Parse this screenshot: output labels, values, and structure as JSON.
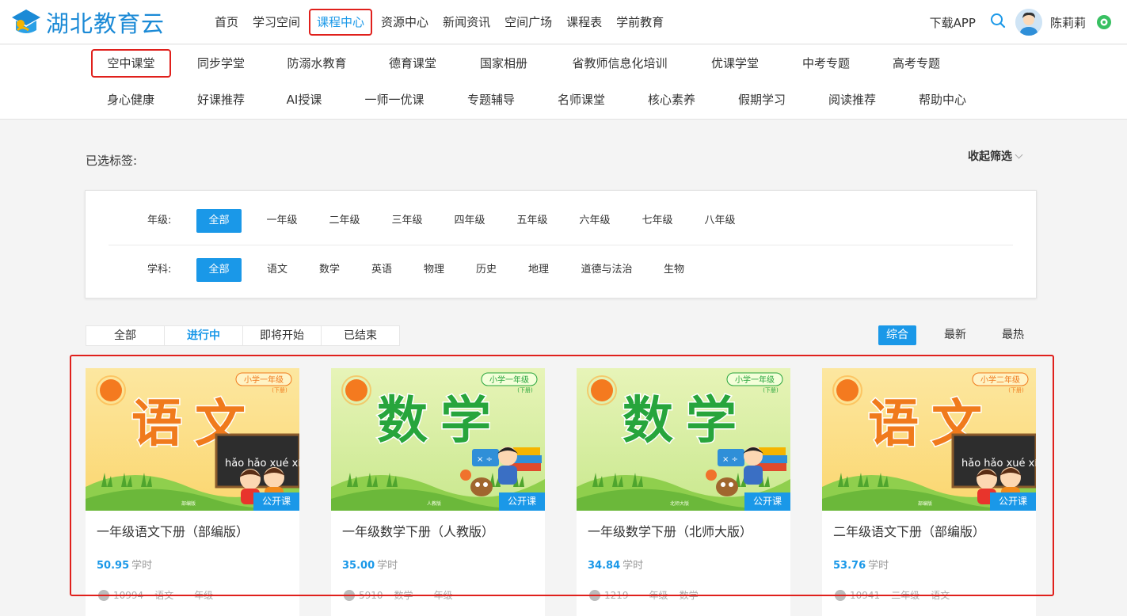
{
  "brand": {
    "name": "湖北教育云"
  },
  "nav": {
    "items": [
      "首页",
      "学习空间",
      "课程中心",
      "资源中心",
      "新闻资讯",
      "空间广场",
      "课程表",
      "学前教育"
    ],
    "active_index": 2
  },
  "user": {
    "download": "下载APP",
    "name": "陈莉莉"
  },
  "subnav": {
    "row1": [
      "空中课堂",
      "同步学堂",
      "防溺水教育",
      "德育课堂",
      "国家相册",
      "省教师信息化培训",
      "优课学堂",
      "中考专题",
      "高考专题"
    ],
    "row2": [
      "身心健康",
      "好课推荐",
      "AI授课",
      "一师一优课",
      "专题辅导",
      "名师课堂",
      "核心素养",
      "假期学习",
      "阅读推荐",
      "帮助中心"
    ],
    "active": "空中课堂"
  },
  "filter": {
    "selected_label": "已选标签:",
    "collapse_label": "收起筛选",
    "grade_label": "年级:",
    "grades": [
      "全部",
      "一年级",
      "二年级",
      "三年级",
      "四年级",
      "五年级",
      "六年级",
      "七年级",
      "八年级"
    ],
    "subject_label": "学科:",
    "subjects": [
      "全部",
      "语文",
      "数学",
      "英语",
      "物理",
      "历史",
      "地理",
      "道德与法治",
      "生物"
    ]
  },
  "status_tabs": [
    "全部",
    "进行中",
    "即将开始",
    "已结束"
  ],
  "status_active": "进行中",
  "sort": [
    "综合",
    "最新",
    "最热"
  ],
  "sort_active": "综合",
  "courses": [
    {
      "title": "一年级语文下册（部编版）",
      "hours": "50.95",
      "hours_unit": "学时",
      "badge": "公开课",
      "cover_text": "语文",
      "cover_tag": "小学一年级",
      "cover_sub": "(下册)",
      "cover_pinyin": "hǎo hǎo xué xí",
      "cover_publisher": "部编版",
      "meta": [
        "10994",
        "语文",
        "一年级"
      ],
      "theme": "orange"
    },
    {
      "title": "一年级数学下册（人教版）",
      "hours": "35.00",
      "hours_unit": "学时",
      "badge": "公开课",
      "cover_text": "数学",
      "cover_tag": "小学一年级",
      "cover_sub": "(下册)",
      "cover_pinyin": "",
      "cover_publisher": "人教版",
      "meta": [
        "5910",
        "数学",
        "一年级"
      ],
      "theme": "green"
    },
    {
      "title": "一年级数学下册（北师大版）",
      "hours": "34.84",
      "hours_unit": "学时",
      "badge": "公开课",
      "cover_text": "数学",
      "cover_tag": "小学一年级",
      "cover_sub": "(下册)",
      "cover_pinyin": "",
      "cover_publisher": "北师大版",
      "meta": [
        "1219",
        "一年级",
        "数学"
      ],
      "theme": "green"
    },
    {
      "title": "二年级语文下册（部编版）",
      "hours": "53.76",
      "hours_unit": "学时",
      "badge": "公开课",
      "cover_text": "语文",
      "cover_tag": "小学二年级",
      "cover_sub": "(下册)",
      "cover_pinyin": "hǎo hǎo xué xí",
      "cover_publisher": "部编版",
      "meta": [
        "10941",
        "二年级",
        "语文"
      ],
      "theme": "orange"
    }
  ],
  "colors": {
    "accent": "#1a98e8",
    "highlight": "#e0201c",
    "orange_text": "#f07a1c",
    "green_text": "#27a53c"
  }
}
